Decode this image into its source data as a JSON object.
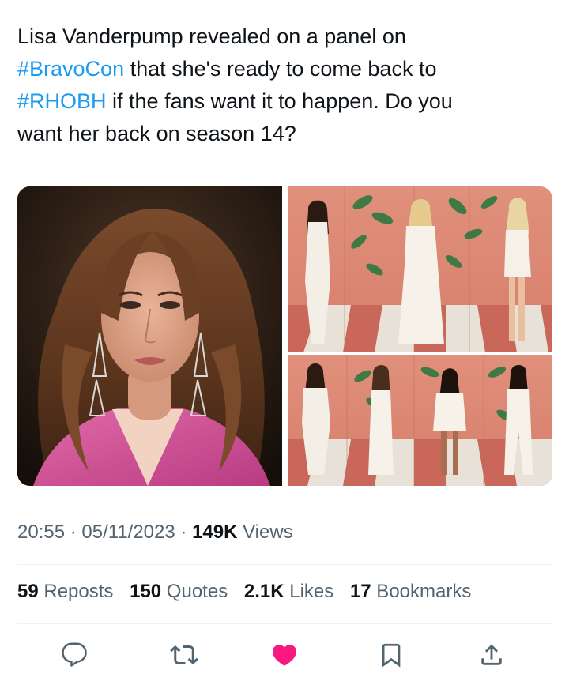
{
  "tweet": {
    "text_line1": "Lisa Vanderpump revealed on a panel on",
    "hashtag1": "#BravoCon",
    "text_line2_rest": " that she's ready to come back to",
    "hashtag2": "#RHOBH",
    "text_line3_rest": " if the fans want it to happen. Do you",
    "text_line4": "want her back on season 14?"
  },
  "media": {
    "left_photo": "portrait",
    "right_photo": "cast-grid"
  },
  "meta": {
    "time": "20:55",
    "sep1": " · ",
    "date": "05/11/2023",
    "sep2": " · ",
    "views_count": "149K",
    "views_label": " Views"
  },
  "stats": {
    "reposts_count": "59",
    "reposts_label": " Reposts",
    "quotes_count": "150",
    "quotes_label": " Quotes",
    "likes_count": "2.1K",
    "likes_label": " Likes",
    "bookmarks_count": "17",
    "bookmarks_label": " Bookmarks"
  },
  "actions": {
    "reply_icon": "reply-icon",
    "repost_icon": "repost-icon",
    "like_icon": "heart-icon",
    "bookmark_icon": "bookmark-icon",
    "share_icon": "share-icon"
  },
  "colors": {
    "accent": "#1d9bf0",
    "like": "#f91880",
    "muted": "#536471",
    "text": "#0f1419"
  }
}
